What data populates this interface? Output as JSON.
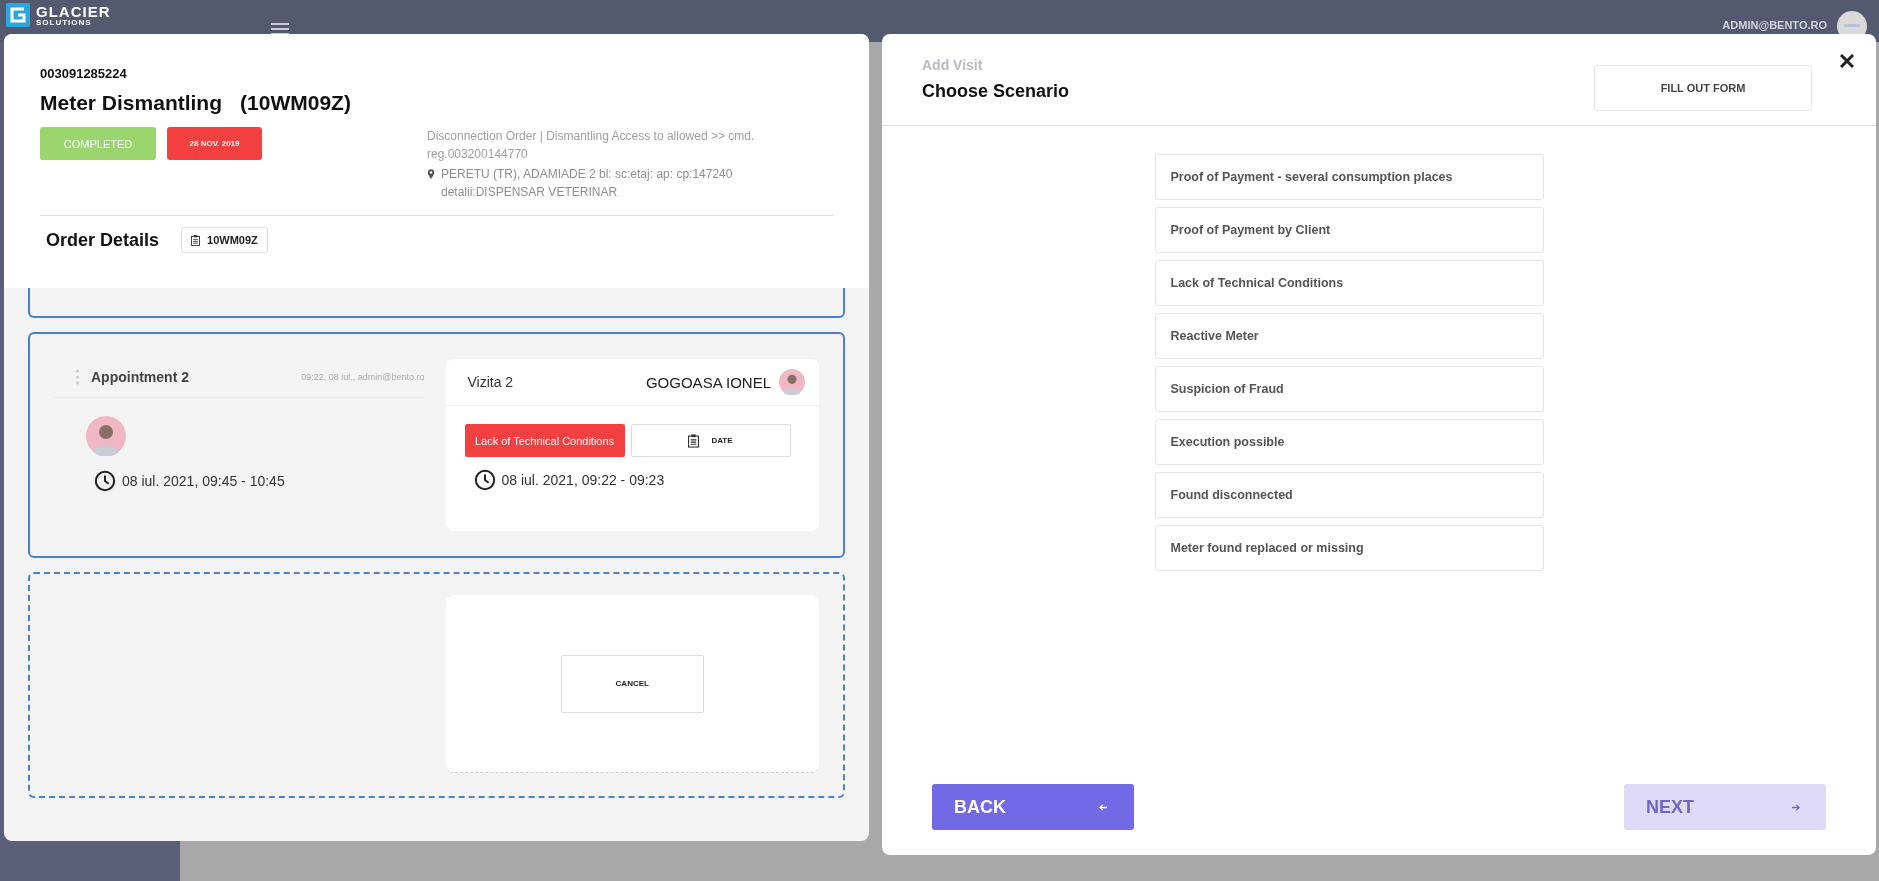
{
  "header": {
    "logo": "GLACIER",
    "tagline": "SOLUTIONS",
    "user": "ADMIN@BENTO.RO"
  },
  "order": {
    "number": "003091285224",
    "title": "Meter Dismantling",
    "code": "(10WM09Z)",
    "status": "COMPLETED",
    "date": "28 NOV. 2019",
    "description": "Disconnection Order | Dismantling  Access to allowed   >> cmd. reg.003200144770",
    "address": "PERETU (TR), ADAMIADE 2 bl: sc:etaj: ap: cp:147240 detalii:DISPENSAR VETERINAR",
    "section_title": "Order Details",
    "tag": "10WM09Z"
  },
  "appointments": [
    {
      "kind": "partial"
    },
    {
      "kind": "appointment",
      "title": "Appointment 2",
      "meta": "09:22, 08 iul., admin@bento.ro",
      "time": "08 iul. 2021, 09:45 - 10:45",
      "visit": {
        "title": "Vizita 2",
        "person": "GOGOASA IONEL",
        "scenario": "Lack of Technical Conditions",
        "date_button": "DATE",
        "time": "08 iul. 2021, 09:22 - 09:23"
      }
    },
    {
      "kind": "new",
      "cancel": "CANCEL"
    }
  ],
  "scenario_panel": {
    "subtitle": "Add Visit",
    "title": "Choose Scenario",
    "fill_button": "FILL OUT FORM",
    "scenarios": [
      {
        "label": "Proof of Payment - several consumption places",
        "selected": false
      },
      {
        "label": "Proof of Payment by Client",
        "selected": false
      },
      {
        "label": "Lack of Technical Conditions",
        "selected": false
      },
      {
        "label": "Reactive Meter",
        "selected": false
      },
      {
        "label": "Suspicion of Fraud",
        "selected": false
      },
      {
        "label": "Execution possible",
        "selected": false
      },
      {
        "label": "Found disconnected",
        "selected": false
      },
      {
        "label": "Meter found replaced or missing",
        "selected": false
      }
    ],
    "back": {
      "label": "BACK",
      "disabled": false
    },
    "next": {
      "label": "NEXT",
      "disabled": true
    }
  }
}
